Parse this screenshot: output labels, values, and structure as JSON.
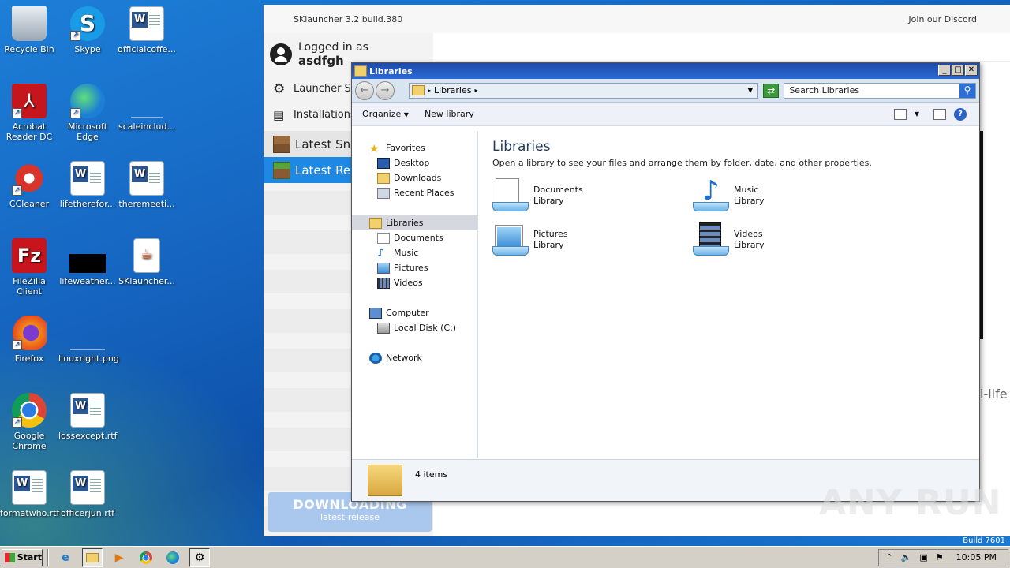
{
  "desktop": {
    "icons": [
      {
        "label": "Recycle Bin",
        "icon": "recycle-bin-icon"
      },
      {
        "label": "Skype",
        "icon": "skype-icon"
      },
      {
        "label": "officialcoffe...",
        "icon": "word-doc-icon"
      },
      {
        "label": "Acrobat Reader DC",
        "icon": "acrobat-icon"
      },
      {
        "label": "Microsoft Edge",
        "icon": "edge-icon"
      },
      {
        "label": "scaleinclud...",
        "icon": "file-icon"
      },
      {
        "label": "CCleaner",
        "icon": "ccleaner-icon"
      },
      {
        "label": "lifetherefor...",
        "icon": "word-doc-icon"
      },
      {
        "label": "theremeeti...",
        "icon": "word-doc-icon"
      },
      {
        "label": "FileZilla Client",
        "icon": "filezilla-icon"
      },
      {
        "label": "lifeweather...",
        "icon": "image-icon"
      },
      {
        "label": "SKlauncher...",
        "icon": "java-jar-icon"
      },
      {
        "label": "Firefox",
        "icon": "firefox-icon"
      },
      {
        "label": "linuxright.png",
        "icon": "image-icon"
      },
      {
        "label": "Google Chrome",
        "icon": "chrome-icon"
      },
      {
        "label": "lossexcept.rtf",
        "icon": "word-doc-icon"
      },
      {
        "label": "formatwho.rtf",
        "icon": "word-doc-icon"
      },
      {
        "label": "officerjun.rtf",
        "icon": "word-doc-icon"
      }
    ]
  },
  "sklauncher": {
    "title": "SKlauncher 3.2 build.380",
    "discord": "Join our Discord",
    "logged_in_as": "Logged in as",
    "username": "asdfgh",
    "nav": [
      "Launcher Se",
      "Installations",
      "Latest Sna",
      "Latest Rel"
    ],
    "download_label": "DOWNLOADING",
    "download_sub": "latest-release",
    "bg_text": "l-life"
  },
  "explorer": {
    "title": "Libraries",
    "address": "Libraries",
    "search_placeholder": "Search Libraries",
    "commands": [
      "Organize",
      "New library"
    ],
    "nav": {
      "favorites": "Favorites",
      "fav_items": [
        "Desktop",
        "Downloads",
        "Recent Places"
      ],
      "libraries": "Libraries",
      "lib_items": [
        "Documents",
        "Music",
        "Pictures",
        "Videos"
      ],
      "computer": "Computer",
      "computer_items": [
        "Local Disk (C:)"
      ],
      "network": "Network"
    },
    "heading": "Libraries",
    "subheading": "Open a library to see your files and arrange them by folder, date, and other properties.",
    "libraries": [
      {
        "name": "Documents",
        "type": "Library"
      },
      {
        "name": "Music",
        "type": "Library"
      },
      {
        "name": "Pictures",
        "type": "Library"
      },
      {
        "name": "Videos",
        "type": "Library"
      }
    ],
    "status": "4 items"
  },
  "taskbar": {
    "start": "Start",
    "clock": "10:05 PM",
    "build": "Build 7601"
  },
  "watermark": "ANY RUN"
}
